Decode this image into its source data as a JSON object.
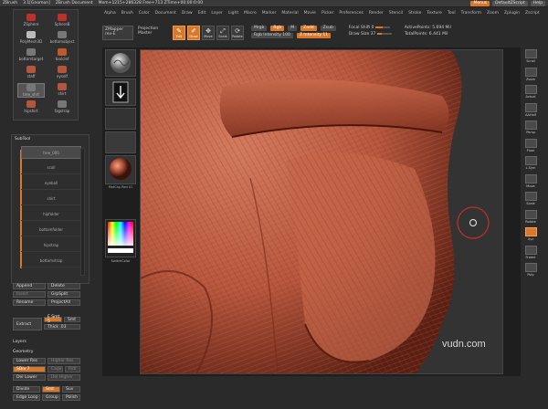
{
  "titlebar": {
    "app": "ZBrush",
    "version": "3.1[Gnomon]",
    "document": "ZBrush Document",
    "stats": "Mem+1215+286328 Free+713 ZTime+00:00:0:00",
    "menu_btn": "Menus",
    "script": "DefaultZScript",
    "help": "Help"
  },
  "menus": [
    "Alpha",
    "Brush",
    "Color",
    "Document",
    "Draw",
    "Edit",
    "Layer",
    "Light",
    "Macro",
    "Marker",
    "Material",
    "Movie",
    "Picker",
    "Preferences",
    "Render",
    "Stencil",
    "Stroke",
    "Texture",
    "Tool",
    "Transform",
    "Zoom",
    "Zplugin",
    "Zscript"
  ],
  "toolbox": {
    "items": [
      {
        "label": "ZSphere"
      },
      {
        "label": "SphereB"
      },
      {
        "label": "PolyMesh3D"
      },
      {
        "label": "bottomobject"
      },
      {
        "label": "bottomtarget"
      },
      {
        "label": "toolclef"
      },
      {
        "label": "staff"
      },
      {
        "label": "eyself"
      },
      {
        "label": "tree_shrt"
      },
      {
        "label": "shirt"
      },
      {
        "label": "hipshirt"
      },
      {
        "label": "fagstrap"
      }
    ]
  },
  "subtool": {
    "title": "SubTool",
    "rows": [
      "tree_000",
      "scall",
      "eyeball",
      "shirt",
      "hipfolder",
      "bottomfolder",
      "hipstrap",
      "bottomstrap"
    ]
  },
  "subtool_buttons": {
    "append": "Append",
    "delete": "Delete",
    "insert": "Insert",
    "group_split": "GrpSplit",
    "rename": "Rename",
    "project_all": "ProjectAll",
    "extract": "Extract",
    "smt": "E Smt 5",
    "smt_toggle": "Smt",
    "thick": "Thick .03",
    "layers": "Layers",
    "geometry": "Geometry",
    "lower_res": "Lower Res",
    "higher_res": "Higher Res",
    "sdiv": "SDiv 7",
    "cage": "Cage",
    "rstr": "Rstr",
    "del_lower": "Del Lower",
    "del_higher": "Del Higher",
    "divide": "Divide",
    "smt2": "Smt",
    "suv": "Suv",
    "edge_loop": "Edge Loop",
    "group": "Group",
    "polish": "Polish"
  },
  "topbar": {
    "zmapper": "ZMapper",
    "zmapper_sub": "rev-E",
    "projection": "Projection",
    "master": "Master",
    "tools": [
      {
        "label": "Edit",
        "glyph": "✎",
        "active": true
      },
      {
        "label": "Draw",
        "glyph": "✐",
        "active": true
      },
      {
        "label": "Move",
        "glyph": "✥",
        "active": false
      },
      {
        "label": "Scale",
        "glyph": "⤢",
        "active": false
      },
      {
        "label": "Rotate",
        "glyph": "⟳",
        "active": false
      }
    ],
    "mrgb": "Mrgb",
    "rgb": "Rgb",
    "m": "M",
    "zadd": "Zadd",
    "zsub": "Zsub",
    "rgb_intensity": "Rgb Intensity 100",
    "z_intensity": "Z Intensity 11",
    "focal_shift": "Focal Shift 0",
    "draw_size": "Draw Size 37",
    "active_points": "ActivePoints: 5.694 Mil",
    "total_points": "TotalPoints: 6.441 Mil"
  },
  "toolstrip": {
    "material_label": "MatCap Red 01",
    "switch_color": "SwitchColor"
  },
  "rightdock": [
    "Scroll",
    "Zoom",
    "Actual",
    "AAHalf",
    "Persp",
    "Floor",
    "L.Sym",
    "Move",
    "Scale",
    "Rotate",
    "Xyz",
    "Frame",
    "Poly"
  ],
  "watermark": "vudn.com",
  "colors": {
    "accent": "#d9782a",
    "panel": "#2e2e2e",
    "skin": "#b5553c"
  }
}
